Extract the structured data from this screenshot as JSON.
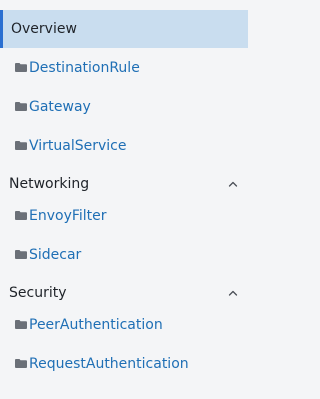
{
  "colors": {
    "background": "#f4f5f7",
    "active_background": "#c9ddef",
    "active_border": "#2a6fd1",
    "link": "#1f6fb5",
    "text": "#1f2329",
    "folder_icon": "#6b7078"
  },
  "nav": {
    "overview": {
      "label": "Overview",
      "selected": true
    },
    "top_items": [
      {
        "label": "DestinationRule",
        "icon": "folder-icon"
      },
      {
        "label": "Gateway",
        "icon": "folder-icon"
      },
      {
        "label": "VirtualService",
        "icon": "folder-icon"
      }
    ],
    "groups": [
      {
        "title": "Networking",
        "expanded": true,
        "toggle_icon": "chevron-up-icon",
        "items": [
          {
            "label": "EnvoyFilter",
            "icon": "folder-icon"
          },
          {
            "label": "Sidecar",
            "icon": "folder-icon"
          }
        ]
      },
      {
        "title": "Security",
        "expanded": true,
        "toggle_icon": "chevron-up-icon",
        "items": [
          {
            "label": "PeerAuthentication",
            "icon": "folder-icon"
          },
          {
            "label": "RequestAuthentication",
            "icon": "folder-icon"
          }
        ]
      }
    ]
  }
}
